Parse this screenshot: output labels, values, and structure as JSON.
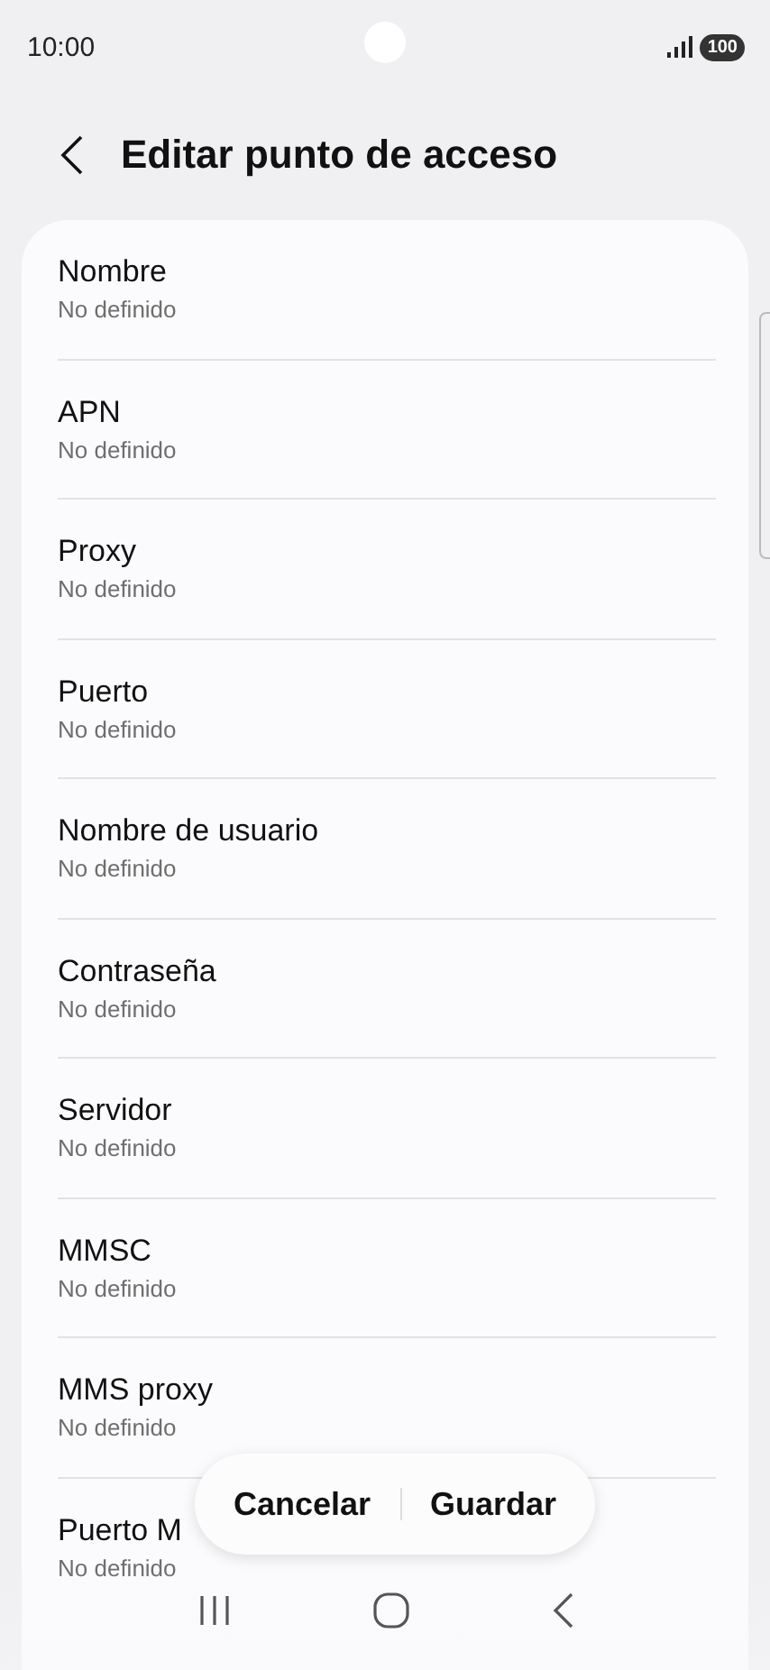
{
  "status_bar": {
    "time": "10:00",
    "battery": "100"
  },
  "header": {
    "title": "Editar punto de acceso"
  },
  "fields": [
    {
      "label": "Nombre",
      "value": "No definido"
    },
    {
      "label": "APN",
      "value": "No definido"
    },
    {
      "label": "Proxy",
      "value": "No definido"
    },
    {
      "label": "Puerto",
      "value": "No definido"
    },
    {
      "label": "Nombre de usuario",
      "value": "No definido"
    },
    {
      "label": "Contraseña",
      "value": "No definido"
    },
    {
      "label": "Servidor",
      "value": "No definido"
    },
    {
      "label": "MMSC",
      "value": "No definido"
    },
    {
      "label": "MMS proxy",
      "value": "No definido"
    },
    {
      "label": "Puerto M",
      "value": "No definido"
    }
  ],
  "actions": [
    {
      "label": "Cancelar"
    },
    {
      "label": "Guardar"
    }
  ]
}
